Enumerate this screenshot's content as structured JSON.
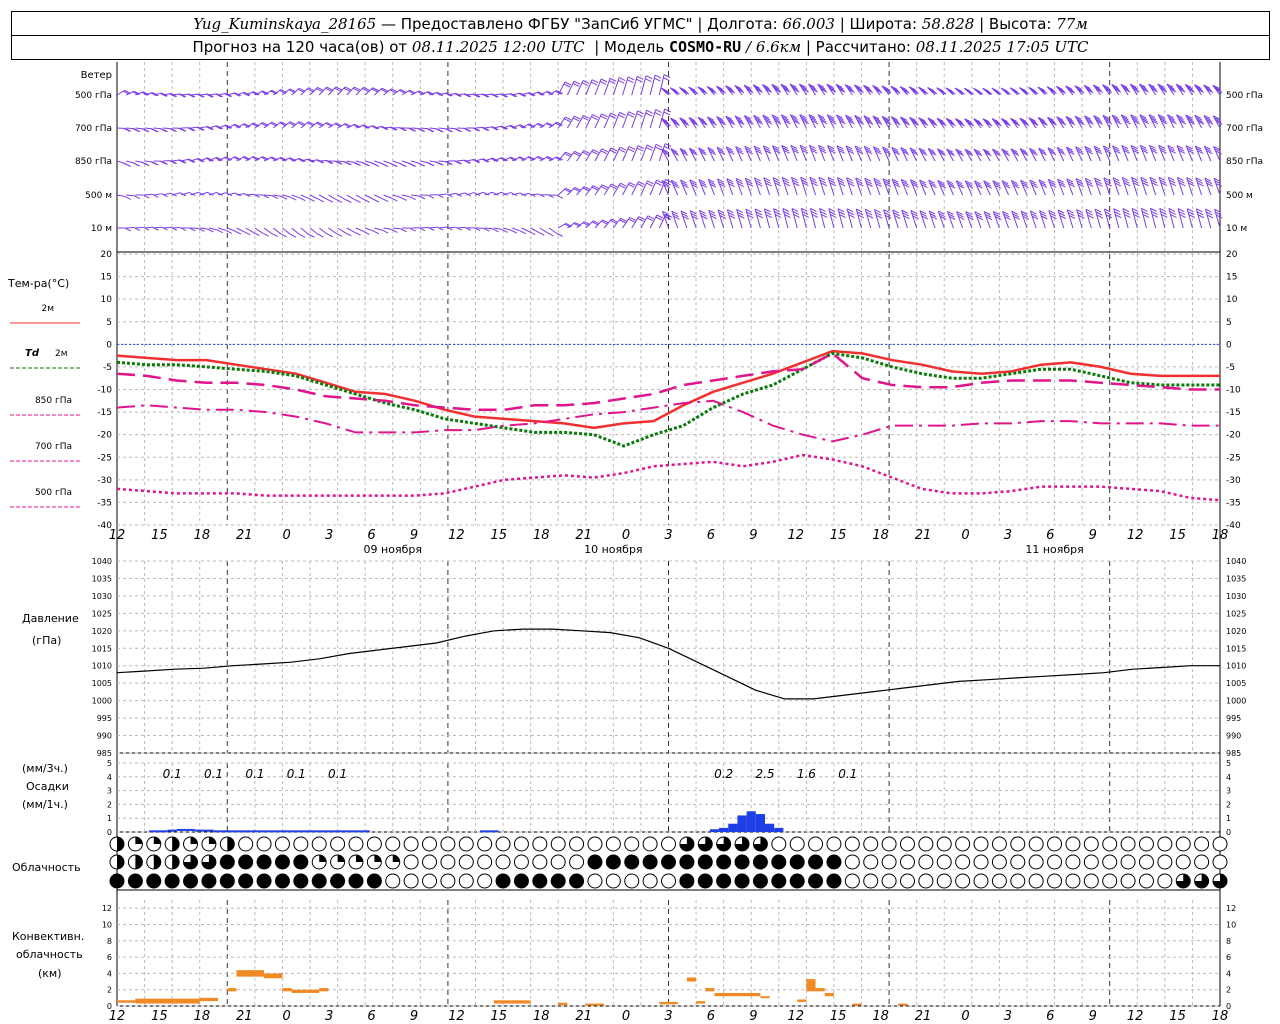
{
  "header": {
    "station": "Yug_Kuminskaya_28165",
    "dash": "—",
    "provided": "Предоставлено ФГБУ \"ЗапСиб УГМС\"",
    "lon_label": "Долгота:",
    "lon": "66.003",
    "lat_label": "Широта:",
    "lat": "58.828",
    "alt_label": "Высота:",
    "alt": "77м",
    "forecast_prefix": "Прогноз на 120 часа(ов) от",
    "forecast_time": "08.11.2025 12:00 UTC",
    "model_label": "Модель",
    "model": "COSMO-RU",
    "resolution": "/ 6.6км",
    "computed_label": "Рассчитано:",
    "computed_time": "08.11.2025 17:05 UTC"
  },
  "colors": {
    "wind": "#7a3ce6",
    "t2m": "#f03030",
    "td2m": "#0a7a0a",
    "magenta": "#e0158c",
    "pressure": "#000000",
    "precip": "#1f3fe6",
    "convective": "#f08a24",
    "zero_line": "#2040ff"
  },
  "time_axis": {
    "hour_labels": [
      "12",
      "15",
      "18",
      "21",
      "0",
      "3",
      "6",
      "9",
      "12",
      "15",
      "18",
      "21",
      "0",
      "3",
      "6",
      "9",
      "12",
      "15",
      "18",
      "21",
      "0",
      "3",
      "6",
      "9",
      "12",
      "15",
      "18"
    ],
    "day_labels": [
      "09 ноября",
      "10 ноября",
      "11 ноября"
    ]
  },
  "wind_panel": {
    "title": "Ветер",
    "levels": [
      "500 гПа",
      "700 гПа",
      "850 гПа",
      "500 м",
      "10 м"
    ]
  },
  "temperature_panel": {
    "title": "Тем-ра(°C)",
    "legend": [
      {
        "label": "2м",
        "color": "#f03030",
        "dash": "solid"
      },
      {
        "label_prefix": "Td",
        "label": "2м",
        "color": "#0a7a0a",
        "dash": "dotted"
      },
      {
        "label": "850 гПа",
        "color": "#e0158c",
        "dash": "long"
      },
      {
        "label": "700 гПа",
        "color": "#e0158c",
        "dash": "dashdot"
      },
      {
        "label": "500 гПа",
        "color": "#e0158c",
        "dash": "dotted"
      }
    ],
    "yticks": [
      "20",
      "15",
      "10",
      "5",
      "0",
      "-5",
      "-10",
      "-15",
      "-20",
      "-25",
      "-30",
      "-35",
      "-40"
    ]
  },
  "pressure_panel": {
    "title_1": "Давление",
    "title_2": "(гПа)",
    "yticks": [
      "1040",
      "1035",
      "1030",
      "1025",
      "1020",
      "1015",
      "1010",
      "1005",
      "1000",
      "995",
      "990",
      "985"
    ]
  },
  "precip_panel": {
    "label_1": "(мм/3ч.)",
    "label_2": "Осадки",
    "label_3": "(мм/1ч.)",
    "yticks": [
      "5",
      "4",
      "3",
      "2",
      "1",
      "0"
    ],
    "annotations": [
      "0.1",
      "0.1",
      "0.1",
      "0.1",
      "0.1",
      "0.2",
      "2.5",
      "1.6",
      "0.1"
    ]
  },
  "cloud_panel": {
    "title": "Облачность"
  },
  "convective_panel": {
    "title_1": "Конвективн.",
    "title_2": "облачность",
    "title_3": "(км)",
    "yticks": [
      "12",
      "10",
      "8",
      "6",
      "4",
      "2",
      "0"
    ]
  },
  "chart_data": [
    {
      "type": "line",
      "title": "Тем-ра(°C)",
      "x_hours": [
        0,
        3,
        6,
        9,
        12,
        15,
        18,
        21,
        24,
        27,
        30,
        33,
        36,
        39,
        42,
        45,
        48,
        51,
        54,
        57,
        60,
        63,
        66,
        69,
        72,
        75,
        78,
        81,
        84,
        87,
        90,
        93,
        96,
        99,
        102,
        105,
        108,
        111,
        114,
        117,
        120
      ],
      "ylim": [
        -40,
        20
      ],
      "series": [
        {
          "name": "2м",
          "values": [
            -2.5,
            -3,
            -3.5,
            -3.5,
            -4.5,
            -5.5,
            -6.5,
            -8.5,
            -10.5,
            -11,
            -12.5,
            -14.5,
            -16,
            -16.5,
            -17,
            -17.5,
            -18.5,
            -17.5,
            -17,
            -13.5,
            -10.5,
            -8.5,
            -6.5,
            -4,
            -1.5,
            -2,
            -3.5,
            -4.5,
            -6,
            -6.5,
            -6,
            -4.5,
            -4,
            -5,
            -6.5,
            -7,
            -7,
            -7
          ]
        },
        {
          "name": "Td 2м",
          "values": [
            -4,
            -4.5,
            -4.5,
            -5,
            -5.5,
            -6,
            -7,
            -9,
            -11,
            -13,
            -14.5,
            -16.5,
            -17.5,
            -18.5,
            -19.5,
            -19.5,
            -20,
            -22.5,
            -20,
            -18,
            -14,
            -11,
            -9,
            -5.5,
            -2,
            -3,
            -5,
            -6.5,
            -7.5,
            -7.5,
            -6.5,
            -5.5,
            -5.5,
            -7,
            -8.5,
            -9,
            -9,
            -9
          ]
        },
        {
          "name": "850 гПа",
          "values": [
            -6.5,
            -7,
            -8,
            -8.5,
            -8.5,
            -9,
            -10,
            -11.5,
            -12,
            -12.5,
            -13.5,
            -14,
            -14.5,
            -14.5,
            -13.5,
            -13.5,
            -13,
            -12,
            -11,
            -9,
            -8,
            -7,
            -6,
            -5.5,
            -2,
            -7.5,
            -9,
            -9.5,
            -9.5,
            -8.5,
            -8,
            -8,
            -8,
            -8.5,
            -9,
            -9.5,
            -10,
            -10
          ]
        },
        {
          "name": "700 гПа",
          "values": [
            -14,
            -13.5,
            -14,
            -14.5,
            -14.5,
            -15,
            -16,
            -17.5,
            -19.5,
            -19.5,
            -19.5,
            -19,
            -19,
            -18,
            -17.5,
            -16.5,
            -15.5,
            -15,
            -14,
            -13,
            -12.5,
            -15,
            -18,
            -20,
            -21.5,
            -20,
            -18,
            -18,
            -18,
            -17.5,
            -17.5,
            -17,
            -17,
            -17.5,
            -17.5,
            -17.5,
            -18,
            -18
          ]
        },
        {
          "name": "500 гПа",
          "values": [
            -32,
            -32.5,
            -33,
            -33,
            -33,
            -33.5,
            -33.5,
            -33.5,
            -33.5,
            -33.5,
            -33.5,
            -33,
            -31.5,
            -30,
            -29.5,
            -29,
            -29.5,
            -28.5,
            -27,
            -26.5,
            -26,
            -27,
            -26,
            -24.5,
            -25.5,
            -27,
            -29.5,
            -32,
            -33,
            -33,
            -32.5,
            -31.5,
            -31.5,
            -31.5,
            -32,
            -32.5,
            -34,
            -34.5
          ]
        }
      ]
    },
    {
      "type": "line",
      "title": "Давление",
      "ylim": [
        985,
        1040
      ],
      "x_hours": [
        0,
        3,
        6,
        9,
        12,
        15,
        18,
        21,
        24,
        27,
        30,
        33,
        36,
        39,
        42,
        45,
        48,
        51,
        54,
        57,
        60,
        63,
        66,
        69,
        72,
        75,
        78,
        81,
        84,
        87,
        90,
        93,
        96,
        99,
        102,
        105,
        108,
        111,
        114,
        117,
        120
      ],
      "values": [
        1008,
        1008.5,
        1009,
        1009.3,
        1010,
        1010.5,
        1011,
        1012,
        1013.5,
        1014.5,
        1015.5,
        1016.5,
        1018.5,
        1020,
        1020.5,
        1020.5,
        1020,
        1019.5,
        1018,
        1015,
        1011,
        1007,
        1003,
        1000.5,
        1000.5,
        1001.5,
        1002.5,
        1003.5,
        1004.5,
        1005.5,
        1006,
        1006.5,
        1007,
        1007.5,
        1008,
        1009,
        1009.5,
        1010,
        1010
      ]
    },
    {
      "type": "bar",
      "title": "Осадки",
      "ylim": [
        0,
        5
      ],
      "x_hours": [
        65,
        66,
        67,
        68,
        69,
        70,
        71,
        72
      ],
      "values": [
        0.2,
        0.3,
        0.6,
        1.2,
        1.5,
        1.3,
        0.6,
        0.3
      ],
      "minor_x_hours": [
        4,
        5,
        6,
        7,
        8,
        9,
        10,
        11,
        12,
        13,
        14,
        15,
        16,
        17,
        18,
        19,
        20,
        21,
        22,
        23,
        24,
        25,
        26,
        27,
        40,
        41
      ],
      "minor_values": [
        0.05,
        0.05,
        0.1,
        0.15,
        0.15,
        0.1,
        0.1,
        0.05,
        0.05,
        0.05,
        0.05,
        0.05,
        0.05,
        0.05,
        0.05,
        0.05,
        0.05,
        0.05,
        0.05,
        0.05,
        0.05,
        0.05,
        0.05,
        0.05,
        0.05,
        0.05
      ]
    },
    {
      "type": "bar",
      "title": "Конвективн. облачность",
      "ylim": [
        0,
        13
      ],
      "bars": [
        {
          "from": 0,
          "to": 2,
          "top": 0.7,
          "base": 0.4
        },
        {
          "from": 2,
          "to": 9,
          "top": 0.9,
          "base": 0.3
        },
        {
          "from": 9,
          "to": 11,
          "top": 1,
          "base": 0.6
        },
        {
          "from": 12,
          "to": 13,
          "top": 2.2,
          "base": 1.8
        },
        {
          "from": 13,
          "to": 16,
          "top": 4.4,
          "base": 3.6
        },
        {
          "from": 16,
          "to": 18,
          "top": 4,
          "base": 3.4
        },
        {
          "from": 18,
          "to": 19,
          "top": 2.2,
          "base": 1.8
        },
        {
          "from": 19,
          "to": 22,
          "top": 2,
          "base": 1.6
        },
        {
          "from": 22,
          "to": 23,
          "top": 2.2,
          "base": 1.8
        },
        {
          "from": 41,
          "to": 45,
          "top": 0.7,
          "base": 0.3
        },
        {
          "from": 48,
          "to": 49,
          "top": 0.4,
          "base": 0.1
        },
        {
          "from": 51,
          "to": 53,
          "top": 0.3,
          "base": 0.1
        },
        {
          "from": 59,
          "to": 61,
          "top": 0.5,
          "base": 0.2
        },
        {
          "from": 62,
          "to": 63,
          "top": 3.5,
          "base": 3.0
        },
        {
          "from": 63,
          "to": 64,
          "top": 0.6,
          "base": 0.3
        },
        {
          "from": 64,
          "to": 65,
          "top": 2.2,
          "base": 1.8
        },
        {
          "from": 65,
          "to": 70,
          "top": 1.6,
          "base": 1.2
        },
        {
          "from": 70,
          "to": 71,
          "top": 1.2,
          "base": 1.0
        },
        {
          "from": 74,
          "to": 75,
          "top": 0.8,
          "base": 0.5
        },
        {
          "from": 75,
          "to": 76,
          "top": 3.3,
          "base": 1.8
        },
        {
          "from": 76,
          "to": 77,
          "top": 2.2,
          "base": 1.8
        },
        {
          "from": 77,
          "to": 78,
          "top": 1.6,
          "base": 1.2
        },
        {
          "from": 80,
          "to": 81,
          "top": 0.3,
          "base": 0.1
        },
        {
          "from": 85,
          "to": 86,
          "top": 0.3,
          "base": 0.1
        }
      ]
    }
  ]
}
